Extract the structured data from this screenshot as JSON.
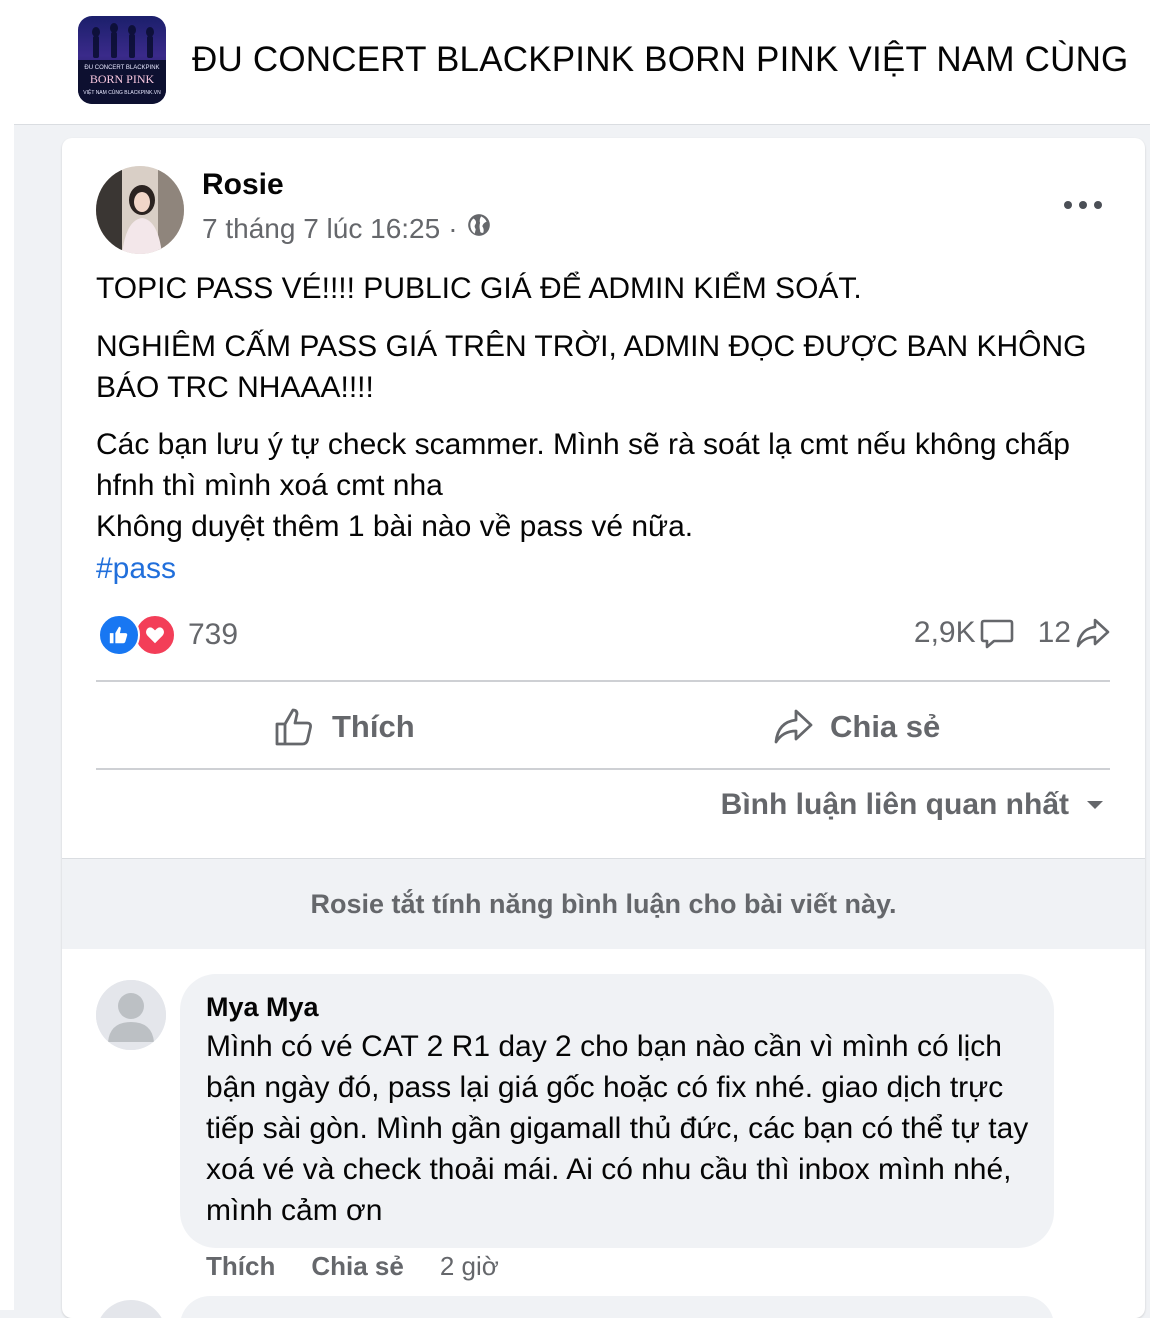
{
  "group": {
    "title": "ĐU CONCERT BLACKPINK BORN PINK VIỆT NAM CÙNG",
    "thumb_line1": "ĐU CONCERT BLACKPINK",
    "thumb_line2": "BORN PINK",
    "thumb_line3": "VIỆT NAM CÙNG BLACKPINK.VN"
  },
  "post": {
    "author": "Rosie",
    "timestamp": "7 tháng 7 lúc 16:25",
    "separator": "·",
    "privacy_icon": "globe-icon",
    "paragraph_1": "TOPIC PASS VÉ!!!! PUBLIC GIÁ ĐỂ ADMIN KIỂM SOÁT.",
    "paragraph_2": "NGHIÊM CẤM PASS GIÁ TRÊN TRỜI, ADMIN ĐỌC ĐƯỢC BAN KHÔNG BÁO TRC NHAAA!!!!",
    "paragraph_3_line1": "Các bạn lưu ý tự check scammer. Mình sẽ rà soát lạ cmt nếu không chấp hfnh thì mình xoá cmt nha",
    "paragraph_3_line2": "Không duyệt thêm 1 bài nào về pass vé nữa.",
    "hashtag": "#pass",
    "reaction_count": "739",
    "comment_count": "2,9K",
    "share_count": "12",
    "like_label": "Thích",
    "share_label": "Chia sẻ",
    "sort_label": "Bình luận liên quan nhất",
    "comments_off_notice": "Rosie tắt tính năng bình luận cho bài viết này.",
    "colors": {
      "link": "#216fdb",
      "like": "#1877f2",
      "love": "#f33e58",
      "muted": "#65676b"
    }
  },
  "comment": {
    "author": "Mya Mya",
    "text": "Mình có vé CAT 2 R1 day 2 cho bạn nào cần vì mình có lịch bận ngày đó, pass lại giá gốc hoặc có fix nhé. giao dịch trực tiếp sài gòn. Mình gần gigamall thủ đức, các bạn có thể tự tay xoá vé và check thoải mái. Ai có nhu cầu thì inbox mình nhé, mình cảm ơn",
    "like_label": "Thích",
    "share_label": "Chia sẻ",
    "time": "2 giờ"
  }
}
